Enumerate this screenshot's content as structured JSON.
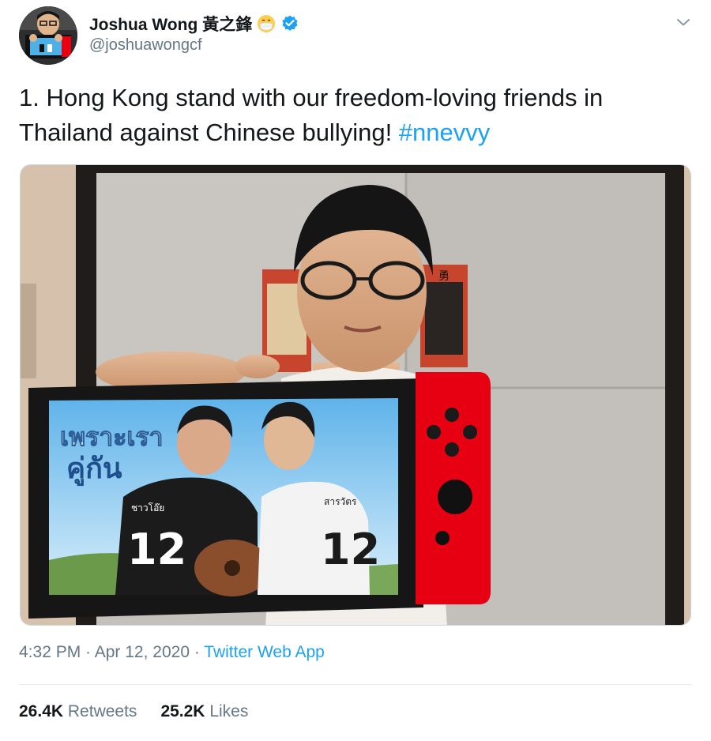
{
  "author": {
    "name": "Joshua Wong 黃之鋒",
    "handle": "@joshuawongcf",
    "verified": true,
    "name_emoji_icon": "face-with-medical-mask-icon",
    "verified_icon": "verified-badge-icon"
  },
  "tweet": {
    "text_main": "1. Hong Kong stand with our freedom-loving friends in Thailand against Chinese bullying! ",
    "hashtag": "#nnevvy"
  },
  "media": {
    "screen_title_line1": "เพราะเรา",
    "screen_title_line2": "คู่กัน",
    "jersey_number_left": "12",
    "jersey_number_right": "12",
    "jersey_name_left": "ชาวโอ๊ย",
    "jersey_name_right": "สารวัตร",
    "poster_glyph": "勇"
  },
  "meta": {
    "time": "4:32 PM",
    "separator1": " · ",
    "date": "Apr 12, 2020",
    "separator2": " · ",
    "source": "Twitter Web App"
  },
  "stats": {
    "retweets_count": "26.4K",
    "retweets_label": "Retweets",
    "likes_count": "25.2K",
    "likes_label": "Likes"
  },
  "colors": {
    "link": "#1da1f2",
    "secondary_text": "#657786",
    "primary_text": "#14171a",
    "verified": "#1da1f2",
    "switch_red": "#e60012"
  },
  "icons": {
    "caret": "chevron-down-icon"
  }
}
